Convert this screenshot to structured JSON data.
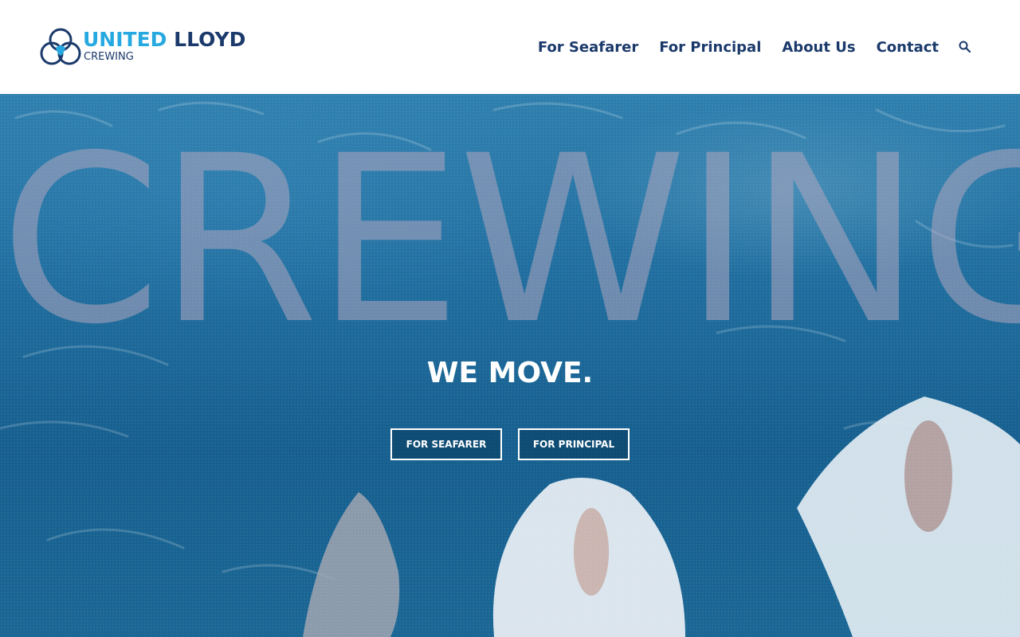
{
  "brand": {
    "name_part1": "UNITED",
    "name_part2": "LLOYD",
    "subtitle": "CREWING",
    "primary_color": "#1b3a6b",
    "accent_color": "#26a9e0"
  },
  "nav": {
    "items": [
      {
        "label": "For Seafarer"
      },
      {
        "label": "For Principal"
      },
      {
        "label": "About Us"
      },
      {
        "label": "Contact"
      }
    ],
    "search_icon": "search-icon"
  },
  "hero": {
    "background_word": "CREWING",
    "tagline": "WE MOVE.",
    "buttons": [
      {
        "label": "FOR SEAFARER"
      },
      {
        "label": "FOR PRINCIPAL"
      }
    ]
  }
}
